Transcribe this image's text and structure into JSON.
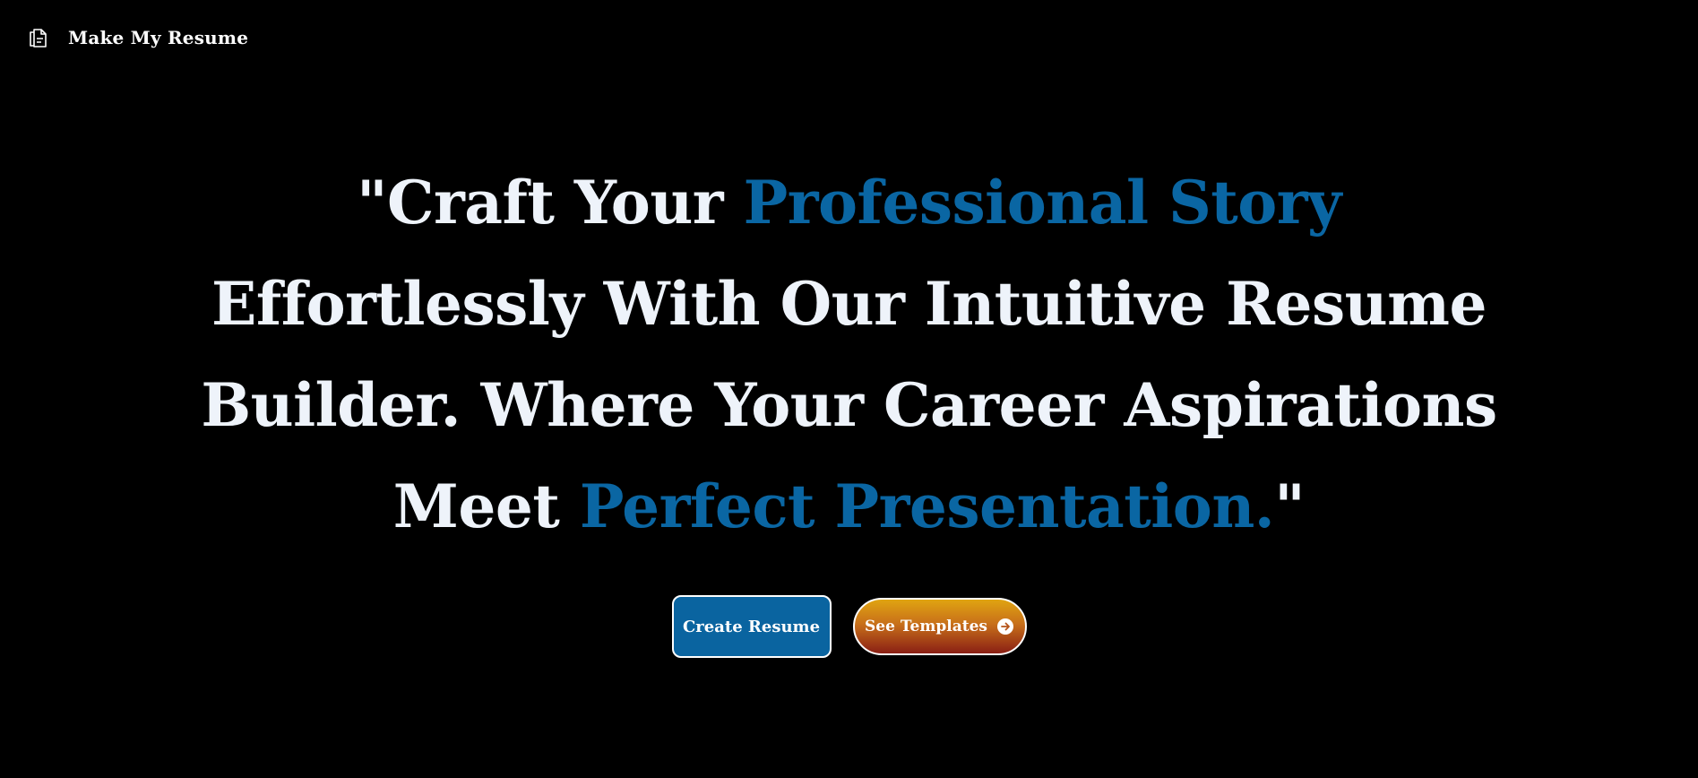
{
  "navbar": {
    "brand": "Make My Resume",
    "logo_icon": "document-copy-icon"
  },
  "hero": {
    "headline_parts": {
      "p1": "\"Craft Your ",
      "p2": "Professional Story",
      "p3": " Effortlessly With Our Intuitive Resume Builder. Where Your Career Aspirations Meet ",
      "p4": "Perfect Presentation.",
      "p5": "\""
    }
  },
  "actions": {
    "create_label": "Create Resume",
    "templates_label": "See Templates",
    "templates_icon": "arrow-right-circle-icon"
  },
  "colors": {
    "background": "#000000",
    "text": "#eef3fa",
    "accent": "#0a66a3",
    "create_button": "#0a64a0",
    "templates_gradient_top": "#e0a411",
    "templates_gradient_bottom": "#8a1f14"
  }
}
